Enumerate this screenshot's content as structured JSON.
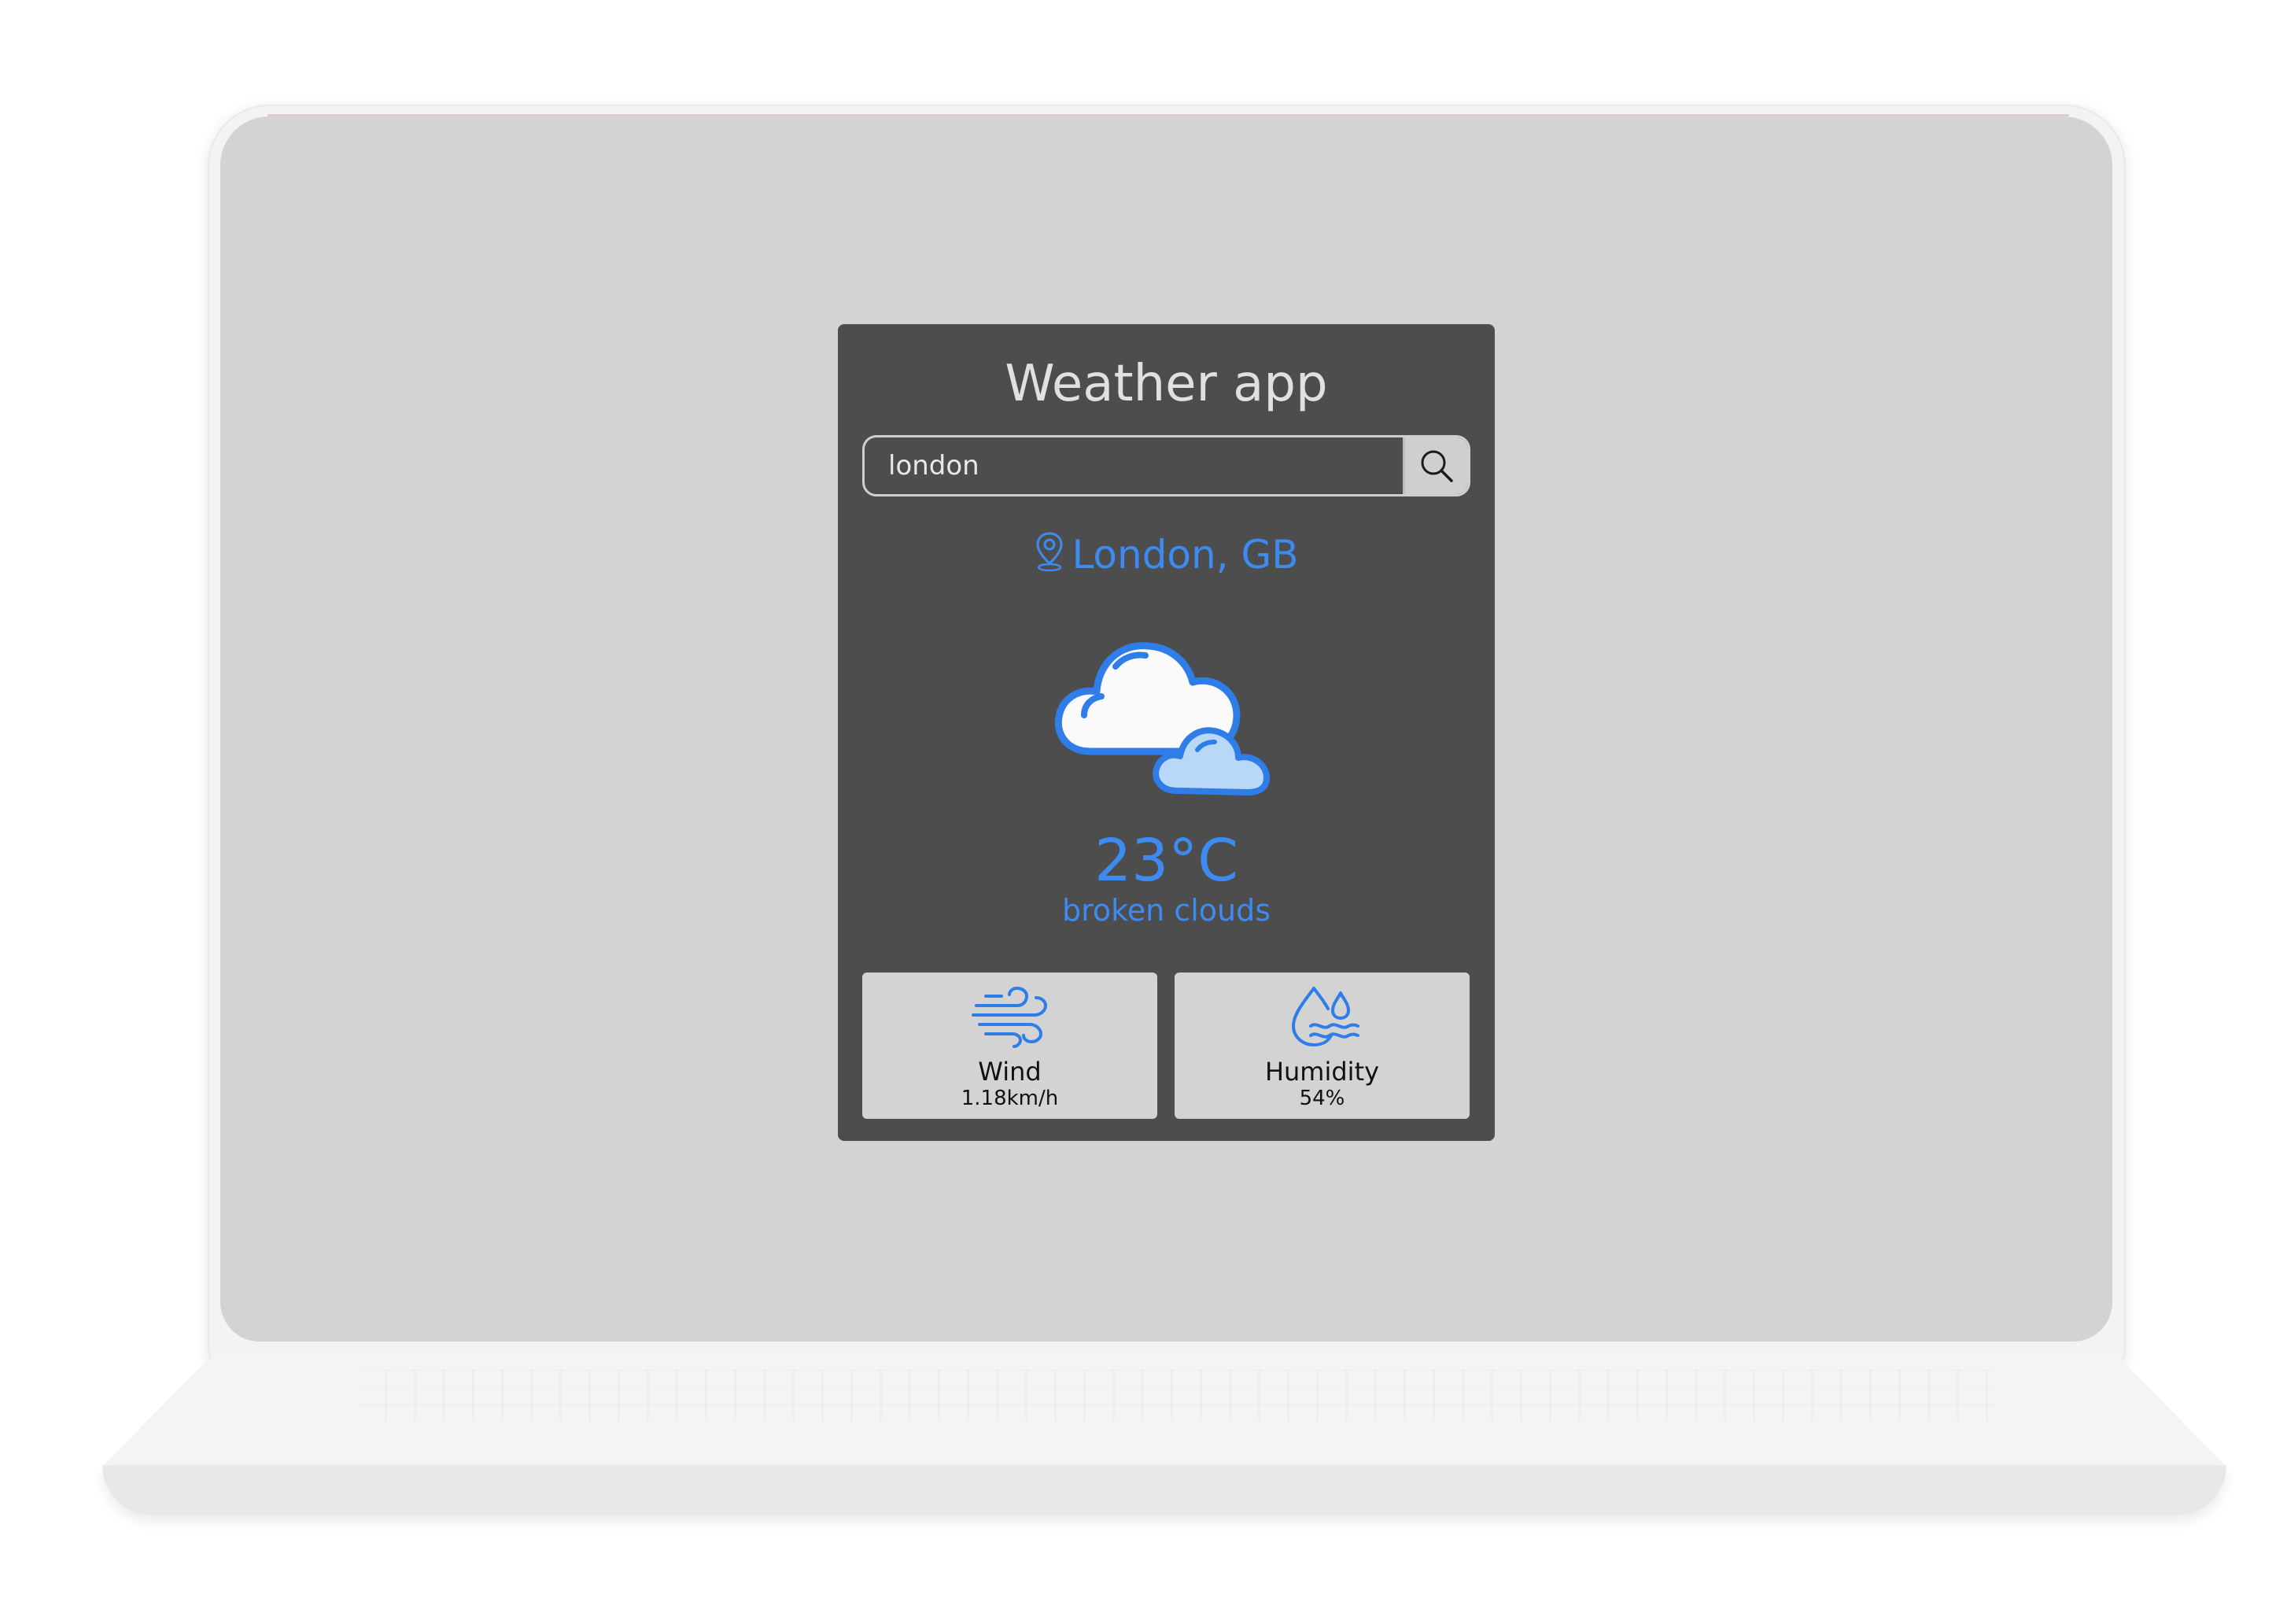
{
  "app": {
    "title": "Weather app"
  },
  "search": {
    "value": "london",
    "button_icon": "search-icon"
  },
  "location": {
    "icon": "map-pin-icon",
    "text": "London, GB"
  },
  "weather": {
    "icon": "broken-clouds-icon",
    "temperature": "23°C",
    "description": "broken clouds"
  },
  "stats": {
    "wind": {
      "icon": "wind-icon",
      "label": "Wind",
      "value": "1.18km/h"
    },
    "humidity": {
      "icon": "humidity-icon",
      "label": "Humidity",
      "value": "54%"
    }
  },
  "colors": {
    "accent": "#3d8bf0",
    "card_background": "#4d4d4d",
    "screen_background": "#d3d3d3",
    "stat_background": "#d3d3d3"
  }
}
